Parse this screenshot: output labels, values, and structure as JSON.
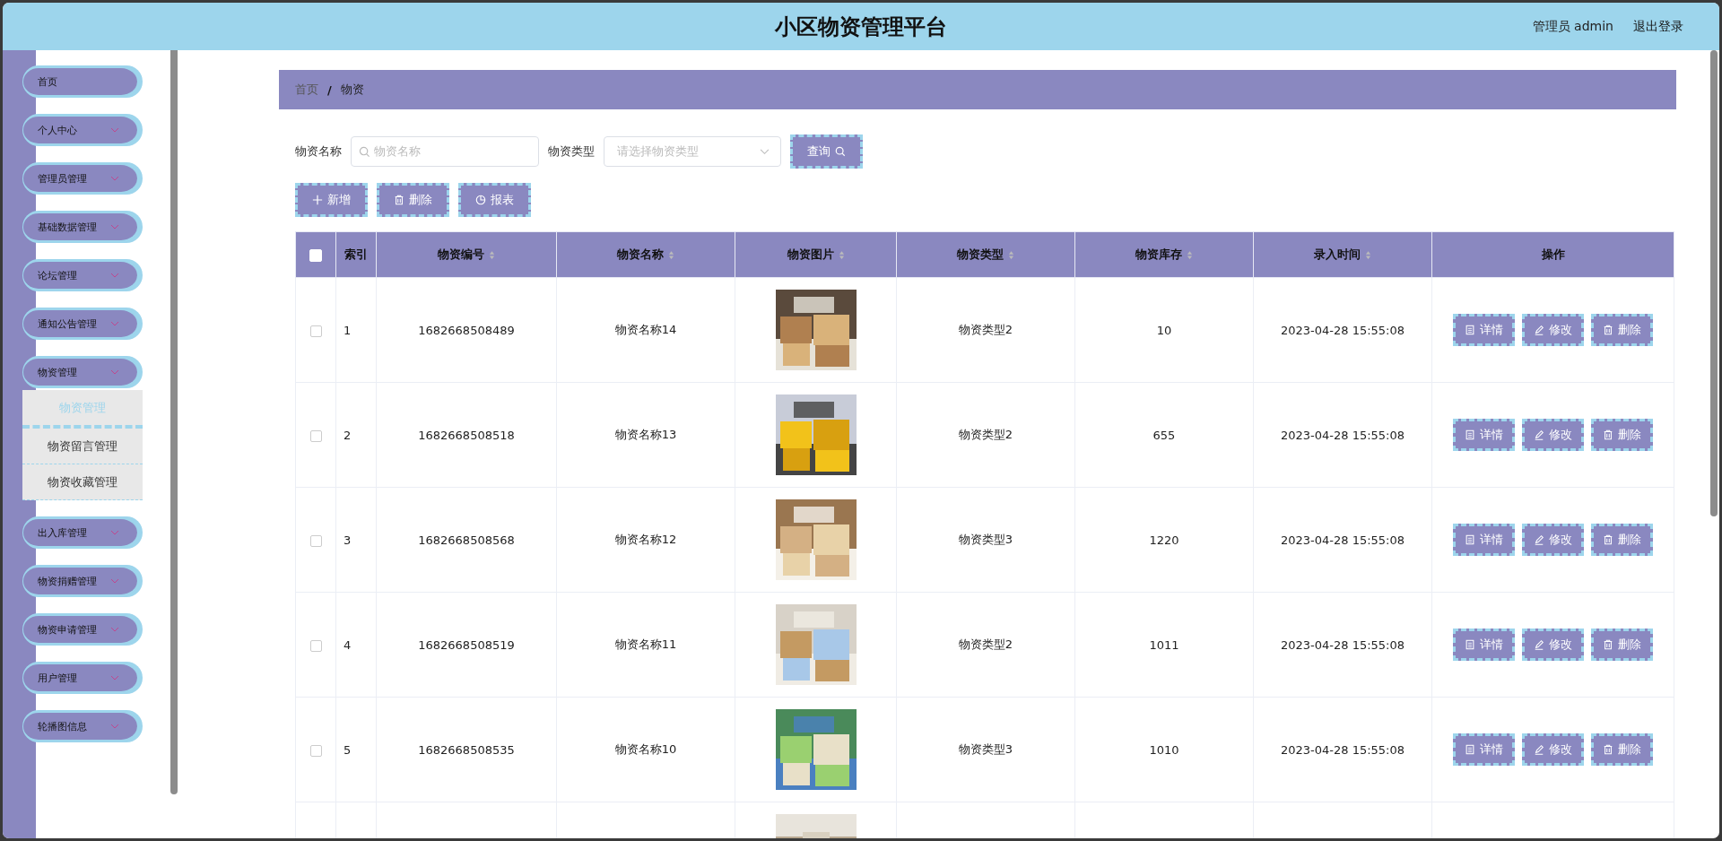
{
  "header": {
    "title": "小区物资管理平台",
    "user": "管理员 admin",
    "logout": "退出登录"
  },
  "sidebar": {
    "items": [
      {
        "label": "首页",
        "kind": "link"
      },
      {
        "label": "个人中心",
        "kind": "menu"
      },
      {
        "label": "管理员管理",
        "kind": "menu"
      },
      {
        "label": "基础数据管理",
        "kind": "menu"
      },
      {
        "label": "论坛管理",
        "kind": "menu"
      },
      {
        "label": "通知公告管理",
        "kind": "menu"
      },
      {
        "label": "物资管理",
        "kind": "menu",
        "children": [
          {
            "label": "物资管理",
            "selected": true
          },
          {
            "label": "物资留言管理",
            "selected": false
          },
          {
            "label": "物资收藏管理",
            "selected": false
          }
        ]
      },
      {
        "label": "出入库管理",
        "kind": "menu"
      },
      {
        "label": "物资捐赠管理",
        "kind": "menu"
      },
      {
        "label": "物资申请管理",
        "kind": "menu"
      },
      {
        "label": "用户管理",
        "kind": "menu"
      },
      {
        "label": "轮播图信息",
        "kind": "menu"
      }
    ]
  },
  "breadcrumb": {
    "items": [
      "首页",
      "物资"
    ],
    "separator": "/"
  },
  "search": {
    "name_label": "物资名称",
    "name_placeholder": "物资名称",
    "type_label": "物资类型",
    "type_placeholder": "请选择物资类型",
    "query": "查询"
  },
  "actions": [
    "新增",
    "删除",
    "报表"
  ],
  "table": {
    "select_all_checked": false,
    "columns": [
      {
        "label": "索引",
        "sortable": false
      },
      {
        "label": "物资编号",
        "sortable": true
      },
      {
        "label": "物资名称",
        "sortable": true
      },
      {
        "label": "物资图片",
        "sortable": true
      },
      {
        "label": "物资类型",
        "sortable": true
      },
      {
        "label": "物资库存",
        "sortable": true
      },
      {
        "label": "录入时间",
        "sortable": true
      },
      {
        "label": "操作",
        "sortable": false
      }
    ],
    "rows": [
      {
        "checked": false,
        "index": "1",
        "code": "1682668508489",
        "name": "物资名称14",
        "type": "物资类型2",
        "stock": "10",
        "time": "2023-04-28 15:55:08",
        "buttons": [
          "详情",
          "修改",
          "删除"
        ]
      },
      {
        "checked": false,
        "index": "2",
        "code": "1682668508518",
        "name": "物资名称13",
        "type": "物资类型2",
        "stock": "655",
        "time": "2023-04-28 15:55:08",
        "buttons": [
          "详情",
          "修改",
          "删除"
        ]
      },
      {
        "checked": false,
        "index": "3",
        "code": "1682668508568",
        "name": "物资名称12",
        "type": "物资类型3",
        "stock": "1220",
        "time": "2023-04-28 15:55:08",
        "buttons": [
          "详情",
          "修改",
          "删除"
        ]
      },
      {
        "checked": false,
        "index": "4",
        "code": "1682668508519",
        "name": "物资名称11",
        "type": "物资类型2",
        "stock": "1011",
        "time": "2023-04-28 15:55:08",
        "buttons": [
          "详情",
          "修改",
          "删除"
        ]
      },
      {
        "checked": false,
        "index": "5",
        "code": "1682668508535",
        "name": "物资名称10",
        "type": "物资类型3",
        "stock": "1010",
        "time": "2023-04-28 15:55:08",
        "buttons": [
          "详情",
          "修改",
          "删除"
        ]
      }
    ]
  }
}
